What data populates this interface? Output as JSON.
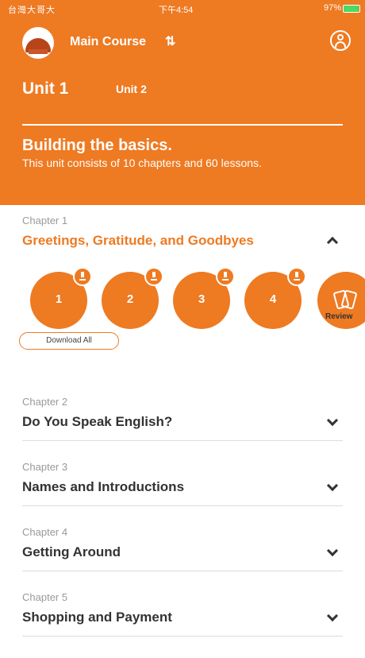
{
  "status_bar": {
    "carrier": "台灣大哥大",
    "time": "下午4:54",
    "battery": "97%"
  },
  "header": {
    "course_title": "Main Course",
    "swap_icon": "swap-icon",
    "profile_icon": "profile-icon"
  },
  "units": {
    "active": "Unit 1",
    "other": "Unit 2"
  },
  "unit_info": {
    "heading": "Building the basics.",
    "description": "This unit consists of 10 chapters and 60 lessons."
  },
  "chapters": [
    {
      "label": "Chapter 1",
      "title": "Greetings, Gratitude, and Goodbyes",
      "lessons": [
        "1",
        "2",
        "3",
        "4"
      ],
      "review_label": "Review",
      "download_label": "Download All"
    },
    {
      "label": "Chapter 2",
      "title": "Do You Speak English?"
    },
    {
      "label": "Chapter 3",
      "title": "Names and Introductions"
    },
    {
      "label": "Chapter 4",
      "title": "Getting Around"
    },
    {
      "label": "Chapter 5",
      "title": "Shopping and Payment"
    }
  ],
  "colors": {
    "accent": "#ee7a22",
    "text": "#333333",
    "muted": "#9a9a9a"
  }
}
